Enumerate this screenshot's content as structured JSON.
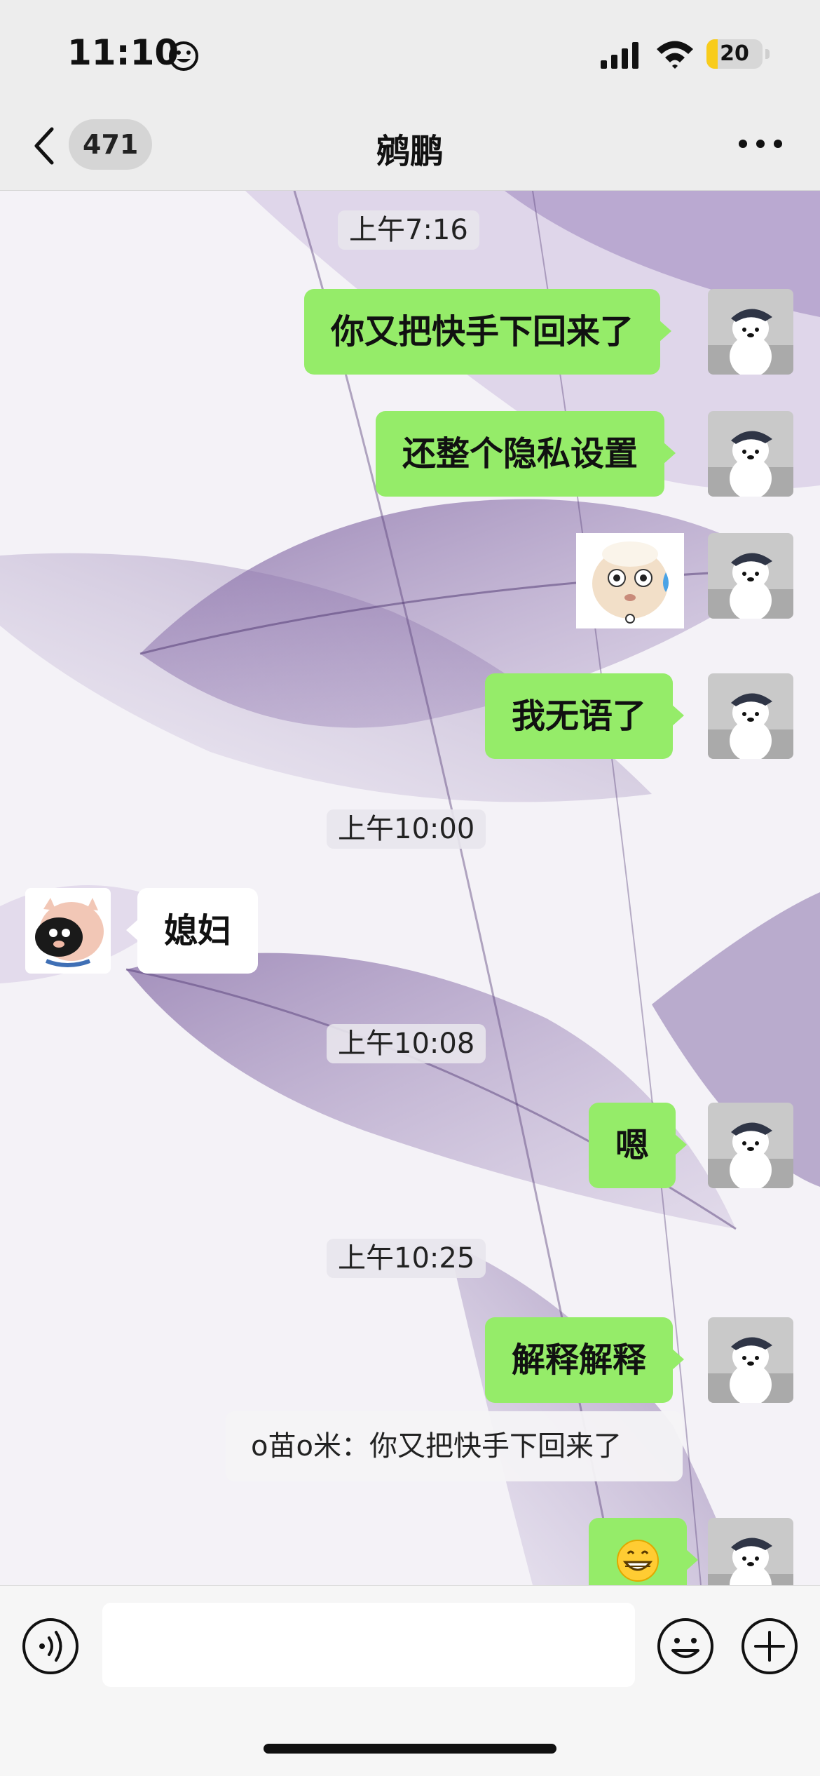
{
  "status_bar": {
    "time": "11:10",
    "battery": "20",
    "battery_level": 0.2
  },
  "nav": {
    "unread_count": "471",
    "title": "鹓鹏"
  },
  "messages": [
    {
      "type": "timestamp",
      "text": "上午7:16"
    },
    {
      "type": "sent",
      "text": "你又把快手下回来了"
    },
    {
      "type": "sent",
      "text": "还整个隐私设置"
    },
    {
      "type": "sent_sticker",
      "sticker": "sweating-sheep-sticker"
    },
    {
      "type": "sent",
      "text": "我无语了"
    },
    {
      "type": "timestamp",
      "text": "上午10:00"
    },
    {
      "type": "received",
      "text": "媳妇"
    },
    {
      "type": "timestamp",
      "text": "上午10:08"
    },
    {
      "type": "sent",
      "text": "嗯"
    },
    {
      "type": "timestamp",
      "text": "上午10:25"
    },
    {
      "type": "sent",
      "text": "解释解释"
    },
    {
      "type": "quote",
      "text": "o苗o米：你又把快手下回来了"
    },
    {
      "type": "sent_emoji",
      "emoji": "😁"
    }
  ],
  "input": {
    "value": "",
    "placeholder": ""
  },
  "icons": {
    "voice": "voice-icon",
    "emoji": "emoji-icon",
    "plus": "plus-icon",
    "back": "chevron-left-icon",
    "more": "more-icon"
  },
  "colors": {
    "sent_bubble": "#95ec69",
    "received_bubble": "#ffffff",
    "battery": "#f8cc1b"
  }
}
